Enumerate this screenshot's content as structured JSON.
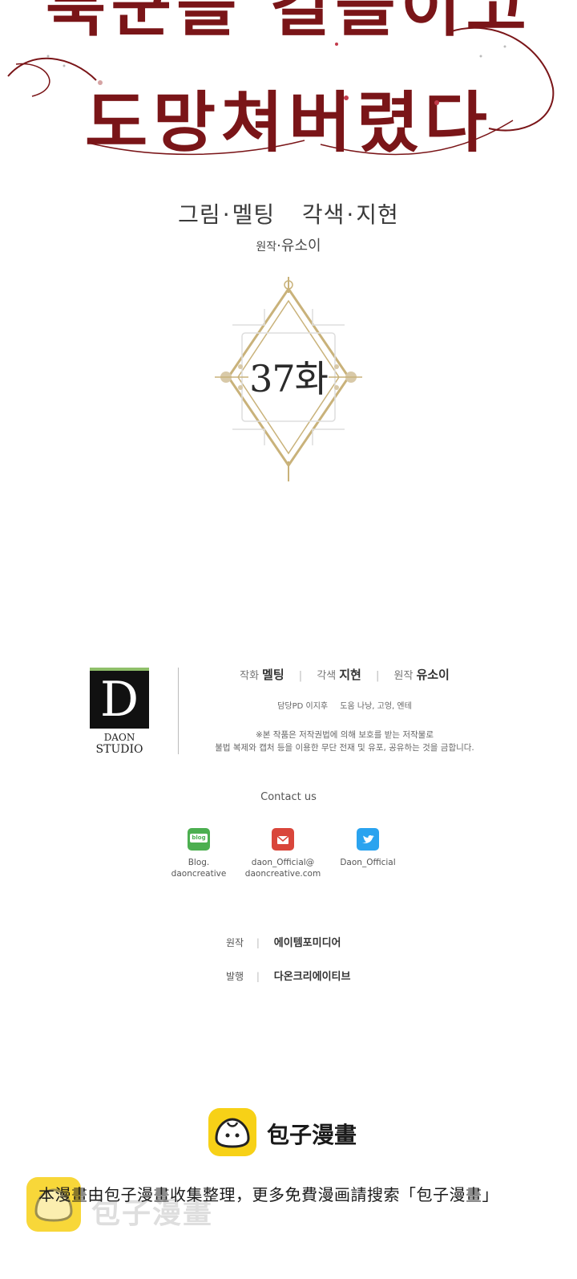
{
  "title": {
    "line1": "북군을 길들이고",
    "line2": "도망쳐버렸다"
  },
  "credits_top": {
    "art_label": "그림",
    "art_name": "멜팅",
    "adapt_label": "각색",
    "adapt_name": "지현",
    "original_label": "원작",
    "original_name": "유소이"
  },
  "episode": "37화",
  "studio": {
    "logo_letter": "D",
    "name_line1": "DAON",
    "name_line2": "STUDIO",
    "row1": {
      "art_label": "작화",
      "art_name": "멜팅",
      "adapt_label": "각색",
      "adapt_name": "지현",
      "original_label": "원작",
      "original_name": "유소이"
    },
    "staff": {
      "pd_label": "담당PD",
      "pd_name": "이지후",
      "help_label": "도움",
      "help_names": "나낭, 고엉, 엔테"
    },
    "copyright_line1": "※본 작품은 저작권법에 의해 보호를 받는 저작물로",
    "copyright_line2": "불법 복제와 캡처 등을 이용한 무단 전재 및 유포, 공유하는 것을 금합니다."
  },
  "contact": {
    "title": "Contact us",
    "items": [
      {
        "icon": "blog-icon",
        "icon_text": "blog",
        "line1": "Blog.",
        "line2": "daoncreative",
        "color": "#4caf50"
      },
      {
        "icon": "mail-icon",
        "line1": "daon_Official@",
        "line2": "daoncreative.com",
        "color": "#d9463b"
      },
      {
        "icon": "twitter-icon",
        "line1": "Daon_Official",
        "line2": "",
        "color": "#2aa3ef"
      }
    ]
  },
  "publishing": {
    "original_label": "원작",
    "original_value": "에이템포미디어",
    "publisher_label": "발행",
    "publisher_value": "다온크리에이티브"
  },
  "source": {
    "brand": "包子漫畫",
    "notice": "本漫畫由包子漫畫收集整理，更多免費漫画請搜索「包子漫畫」",
    "watermark": "包子漫畫"
  }
}
